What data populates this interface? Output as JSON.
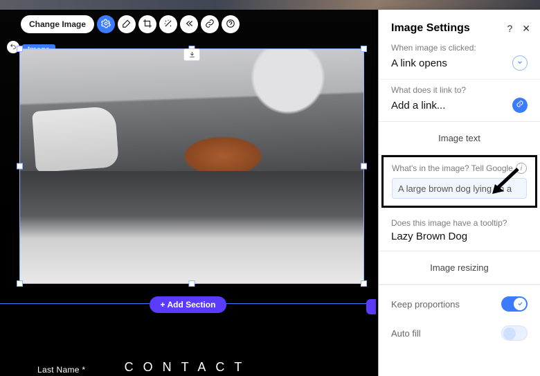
{
  "toolbar": {
    "change_image": "Change Image",
    "image_label": "Image"
  },
  "add_section": "+  Add Section",
  "footer": {
    "left": "Last Name *",
    "center": "CONTACT"
  },
  "panel": {
    "title": "Image Settings",
    "click": {
      "label": "When image is clicked:",
      "value": "A link opens"
    },
    "link": {
      "label": "What does it link to?",
      "value": "Add a link..."
    },
    "image_text_header": "Image text",
    "alt": {
      "label": "What's in the image? Tell Google",
      "value": "A large brown dog lying on a"
    },
    "tooltip": {
      "label": "Does this image have a tooltip?",
      "value": "Lazy Brown Dog"
    },
    "resizing_header": "Image resizing",
    "keep_prop": {
      "label": "Keep proportions"
    },
    "autofill": {
      "label": "Auto fill"
    }
  }
}
